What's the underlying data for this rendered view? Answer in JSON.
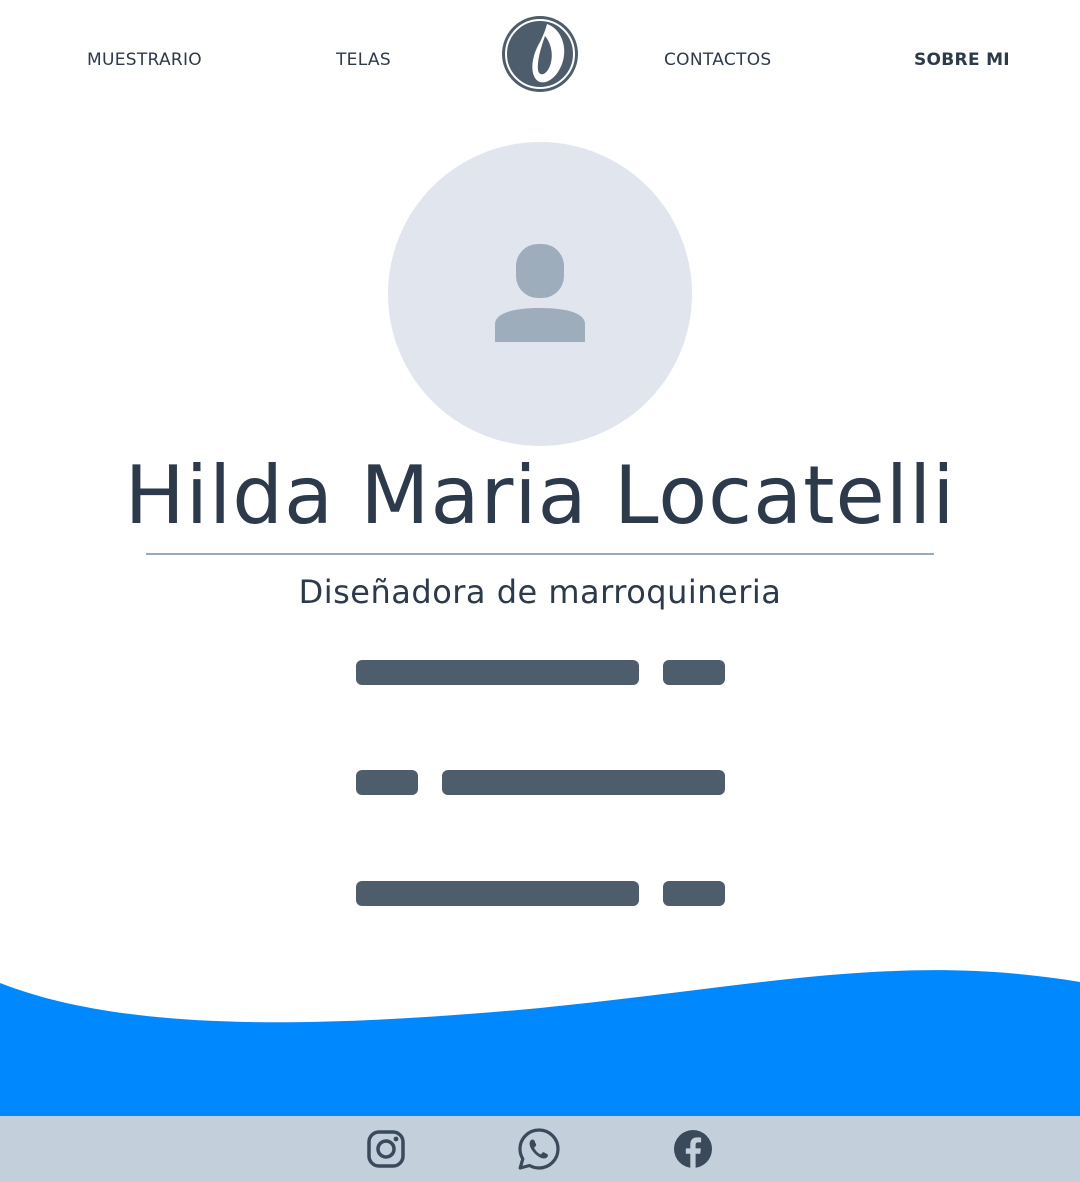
{
  "nav": {
    "items": [
      {
        "label": "MUESTRARIO"
      },
      {
        "label": "TELAS"
      },
      {
        "label": "CONTACTOS"
      },
      {
        "label": "SOBRE MI"
      }
    ],
    "active": "SOBRE MI"
  },
  "logo": {
    "icon": "brand-logo-icon"
  },
  "profile": {
    "avatar_icon": "user-placeholder-icon",
    "name": "Hilda Maria Locatelli",
    "role": "Diseñadora de marroquineria"
  },
  "footer": {
    "social": [
      {
        "icon": "instagram-icon"
      },
      {
        "icon": "whatsapp-icon"
      },
      {
        "icon": "facebook-icon"
      }
    ]
  },
  "colors": {
    "text": "#2c3a4b",
    "avatar_bg": "#e1e6ee",
    "avatar_icon": "#9eadbb",
    "skeleton": "#4e5d6c",
    "wave": "#0088ff",
    "footer_bg": "#c3cfdb"
  }
}
